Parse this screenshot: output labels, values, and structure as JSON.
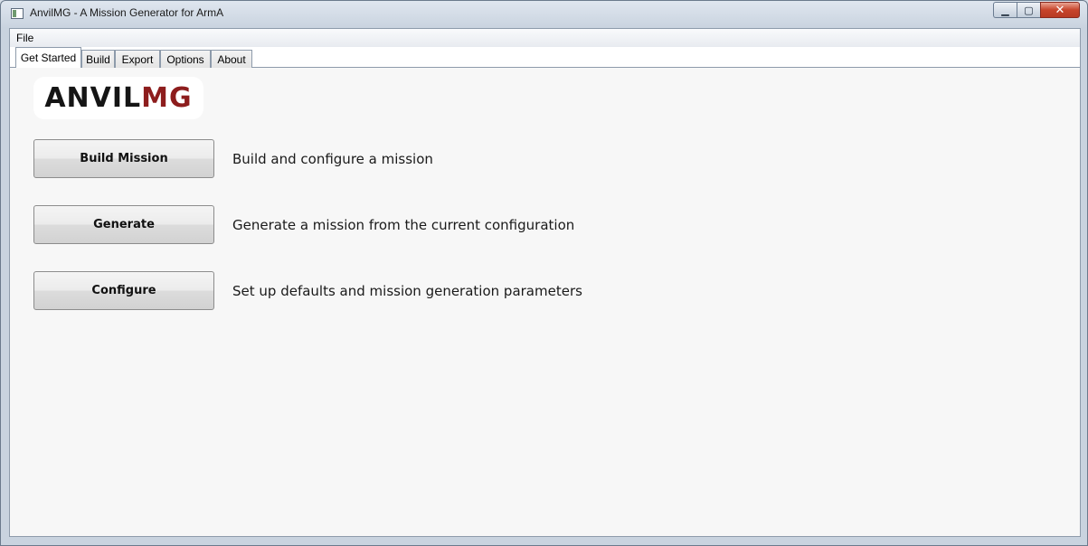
{
  "window": {
    "title": "AnvilMG - A Mission Generator for ArmA",
    "minimize_glyph": "▁",
    "maximize_glyph": "▢",
    "close_glyph": "✕"
  },
  "menu": {
    "file_label": "File"
  },
  "tabs": [
    {
      "label": "Get Started",
      "active": true
    },
    {
      "label": "Build",
      "active": false
    },
    {
      "label": "Export",
      "active": false
    },
    {
      "label": "Options",
      "active": false
    },
    {
      "label": "About",
      "active": false
    }
  ],
  "logo": {
    "part1": "ANVIL",
    "part2": "MG"
  },
  "actions": [
    {
      "label": "Build Mission",
      "description": "Build and configure a mission"
    },
    {
      "label": "Generate",
      "description": "Generate a mission from the current configuration"
    },
    {
      "label": "Configure",
      "description": "Set up defaults and mission generation parameters"
    }
  ],
  "colors": {
    "logo_dark": "#151515",
    "logo_accent": "#8d1d1d",
    "close_button": "#c7442b"
  }
}
